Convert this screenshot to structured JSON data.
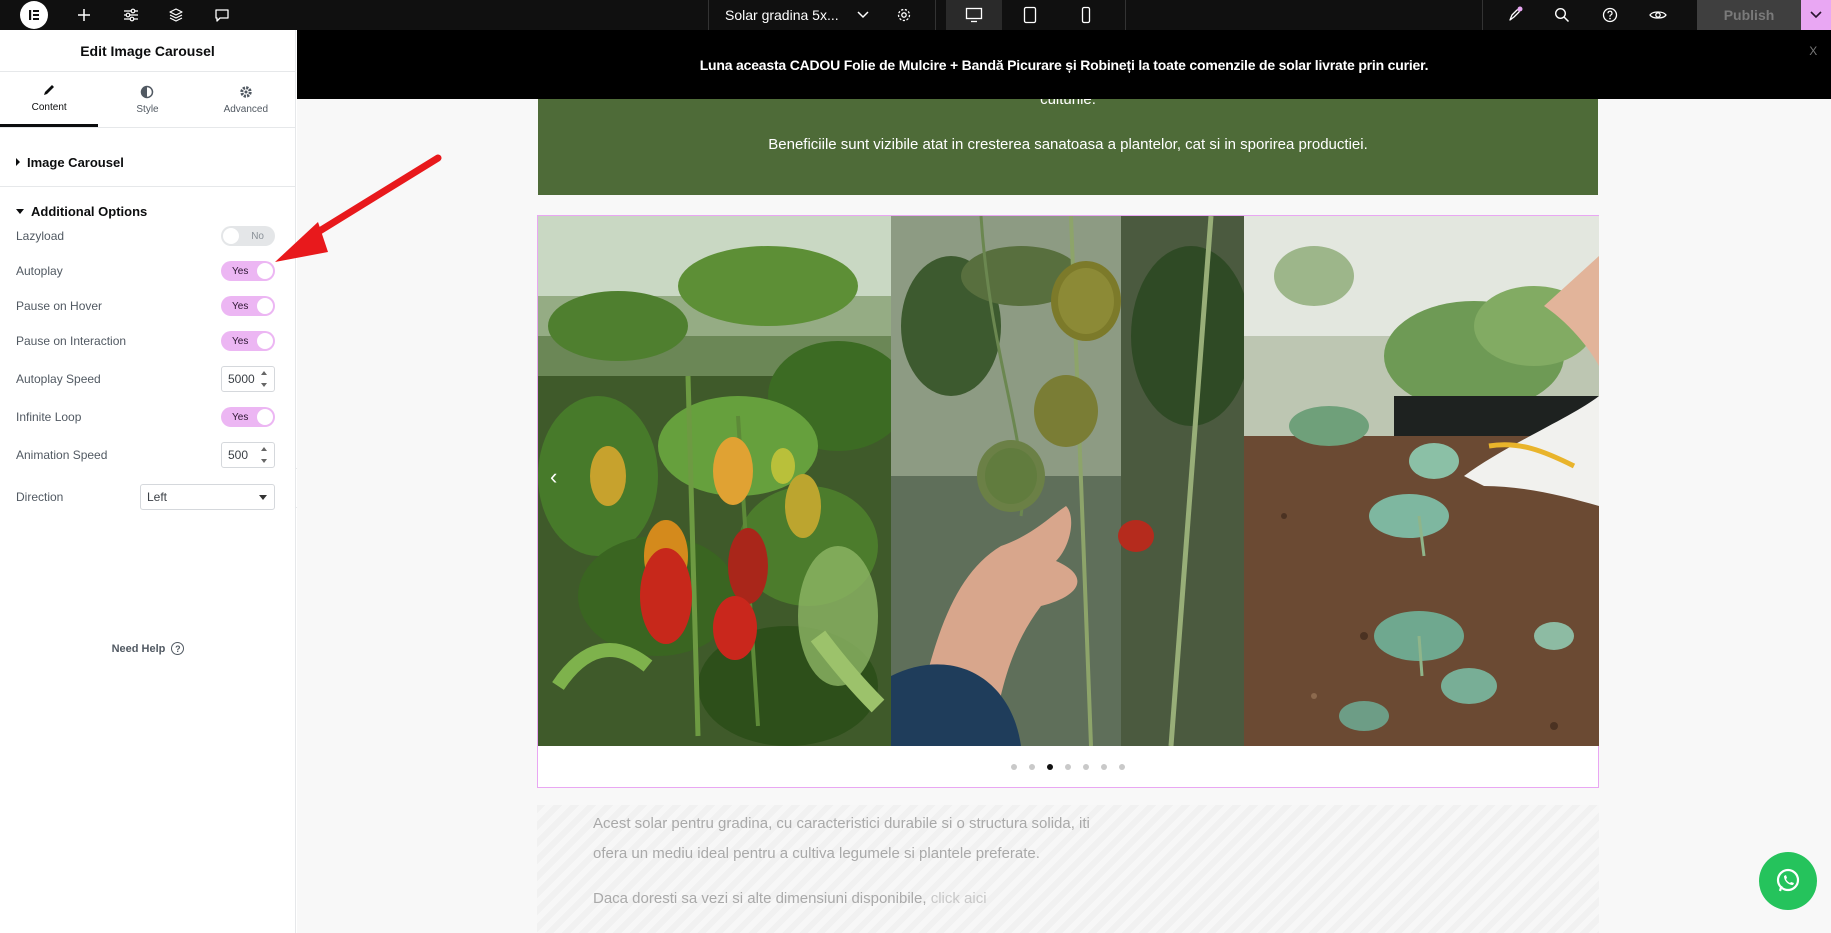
{
  "topbar": {
    "document_title": "Solar gradina 5x...",
    "publish_label": "Publish"
  },
  "panel": {
    "title": "Edit Image Carousel",
    "tabs": [
      {
        "label": "Content",
        "icon": "pencil-icon"
      },
      {
        "label": "Style",
        "icon": "half-circle-icon"
      },
      {
        "label": "Advanced",
        "icon": "gear-icon"
      }
    ],
    "sections": {
      "image_carousel": "Image Carousel",
      "additional_options": "Additional Options"
    },
    "controls": {
      "lazyload": {
        "label": "Lazyload",
        "state": "No"
      },
      "autoplay": {
        "label": "Autoplay",
        "state": "Yes"
      },
      "pause_on_hover": {
        "label": "Pause on Hover",
        "state": "Yes"
      },
      "pause_on_interaction": {
        "label": "Pause on Interaction",
        "state": "Yes"
      },
      "autoplay_speed": {
        "label": "Autoplay Speed",
        "value": "5000"
      },
      "infinite_loop": {
        "label": "Infinite Loop",
        "state": "Yes"
      },
      "animation_speed": {
        "label": "Animation Speed",
        "value": "500"
      },
      "direction": {
        "label": "Direction",
        "value": "Left"
      }
    },
    "help": "Need Help"
  },
  "canvas": {
    "announcement": "Luna aceasta CADOU Folie de Mulcire + Bandă Picurare și Robineți la toate comenzile de solar livrate prin curier.",
    "announcement_close": "X",
    "green_text_1": "culturile.",
    "green_text_2": "Beneficiile sunt vizibile atat in cresterea sanatoasa a plantelor, cat si in sporirea productiei.",
    "carousel": {
      "slides": [
        "Ardei in sera",
        "Rosii culese de mana",
        "Rasaduri plantate in sol"
      ],
      "dot_count": 7,
      "active_dot": 3
    },
    "text_1a": "Acest solar pentru gradina, cu caracteristici durabile si o structura solida, iti",
    "text_1b": "ofera un mediu ideal pentru a cultiva legumele si plantele preferate.",
    "text_2": "Daca doresti sa vezi si alte dimensiuni disponibile,",
    "text_2_link": "click aici"
  },
  "colors": {
    "accent_pink": "#e9a7f3",
    "switch_on": "#ecb6f3",
    "green_band": "#4e6b38",
    "whatsapp": "#25c35c",
    "annotation_arrow": "#e8191c"
  }
}
